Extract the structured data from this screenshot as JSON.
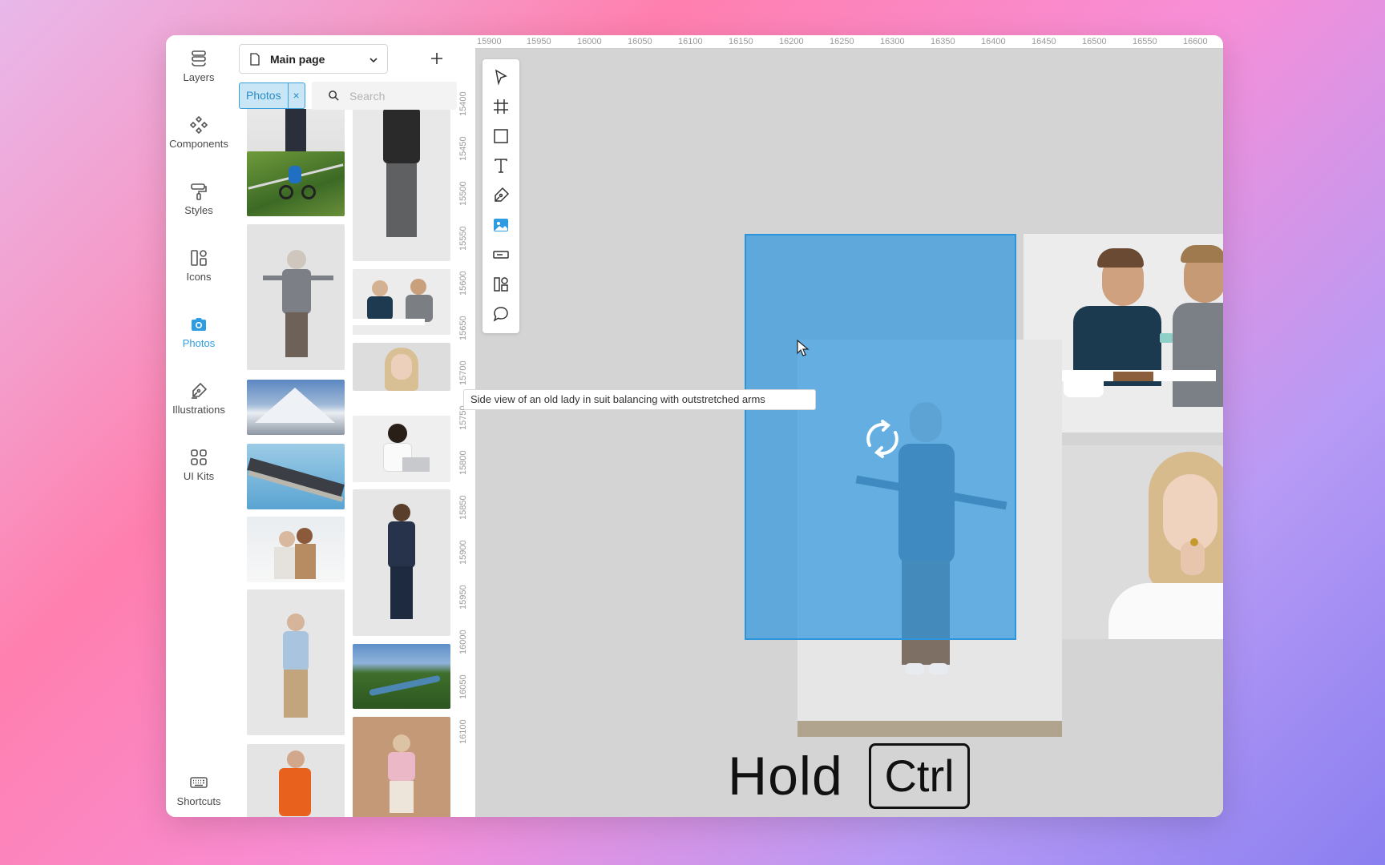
{
  "nav": {
    "items": [
      {
        "label": "Layers"
      },
      {
        "label": "Components"
      },
      {
        "label": "Styles"
      },
      {
        "label": "Icons"
      },
      {
        "label": "Photos"
      },
      {
        "label": "Illustrations"
      },
      {
        "label": "UI Kits"
      }
    ],
    "shortcuts": "Shortcuts"
  },
  "panel": {
    "page_title": "Main page",
    "filter_chip": "Photos",
    "filter_chip_close": "×",
    "search_placeholder": "Search"
  },
  "ruler": {
    "h_labels": [
      "15900",
      "15950",
      "16000",
      "16050",
      "16100",
      "16150",
      "16200",
      "16250",
      "16300",
      "16350",
      "16400",
      "16450",
      "16500",
      "16550",
      "16600"
    ],
    "v_labels": [
      "15400",
      "15450",
      "15500",
      "15550",
      "15600",
      "15650",
      "15700",
      "15750",
      "15800",
      "15850",
      "15900",
      "15950",
      "16000",
      "16050",
      "16100"
    ]
  },
  "tooltip": "Side view of an old lady in suit balancing with outstretched arms",
  "hint": {
    "word": "Hold",
    "key": "Ctrl"
  },
  "colors": {
    "accent": "#2d9ce0",
    "selection": "#4aa8e0",
    "canvas": "#d4d4d4"
  },
  "tools": [
    "pointer-icon",
    "frame-icon",
    "rectangle-icon",
    "text-icon",
    "pen-icon",
    "image-icon",
    "input-icon",
    "components-icon",
    "comment-icon"
  ]
}
